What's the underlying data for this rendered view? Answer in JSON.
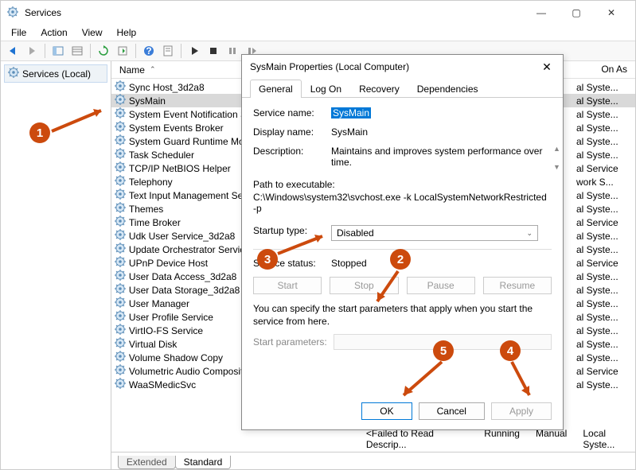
{
  "window": {
    "title": "Services",
    "menus": [
      "File",
      "Action",
      "View",
      "Help"
    ],
    "tree_node": "Services (Local)"
  },
  "list": {
    "col_name": "Name",
    "col_logon": "On As",
    "items": [
      {
        "name": "Sync Host_3d2a8",
        "logon": "al Syste..."
      },
      {
        "name": "SysMain",
        "logon": "al Syste...",
        "selected": true
      },
      {
        "name": "System Event Notification Se",
        "logon": "al Syste..."
      },
      {
        "name": "System Events Broker",
        "logon": "al Syste..."
      },
      {
        "name": "System Guard Runtime Mon",
        "logon": "al Syste..."
      },
      {
        "name": "Task Scheduler",
        "logon": "al Syste..."
      },
      {
        "name": "TCP/IP NetBIOS Helper",
        "logon": "al Service"
      },
      {
        "name": "Telephony",
        "logon": "work S..."
      },
      {
        "name": "Text Input Management Servi",
        "logon": "al Syste..."
      },
      {
        "name": "Themes",
        "logon": "al Syste..."
      },
      {
        "name": "Time Broker",
        "logon": "al Service"
      },
      {
        "name": "Udk User Service_3d2a8",
        "logon": "al Syste..."
      },
      {
        "name": "Update Orchestrator Service",
        "logon": "al Syste..."
      },
      {
        "name": "UPnP Device Host",
        "logon": "al Service"
      },
      {
        "name": "User Data Access_3d2a8",
        "logon": "al Syste..."
      },
      {
        "name": "User Data Storage_3d2a8",
        "logon": "al Syste..."
      },
      {
        "name": "User Manager",
        "logon": "al Syste..."
      },
      {
        "name": "User Profile Service",
        "logon": "al Syste..."
      },
      {
        "name": "VirtIO-FS Service",
        "logon": "al Syste..."
      },
      {
        "name": "Virtual Disk",
        "logon": "al Syste..."
      },
      {
        "name": "Volume Shadow Copy",
        "logon": "al Syste..."
      },
      {
        "name": "Volumetric Audio Composito",
        "logon": "al Service"
      },
      {
        "name": "WaaSMedicSvc",
        "logon": "al Syste..."
      }
    ],
    "bottom_tabs": {
      "extended": "Extended",
      "standard": "Standard"
    },
    "status_cells": {
      "desc": "<Failed to Read Descrip...",
      "state": "Running",
      "startup": "Manual",
      "logon": "Local Syste..."
    }
  },
  "dialog": {
    "title": "SysMain Properties (Local Computer)",
    "tabs": [
      "General",
      "Log On",
      "Recovery",
      "Dependencies"
    ],
    "labels": {
      "service_name": "Service name:",
      "display_name": "Display name:",
      "description": "Description:",
      "path": "Path to executable:",
      "startup": "Startup type:",
      "status": "Service status:",
      "note": "You can specify the start parameters that apply when you start the service from here.",
      "start_params": "Start parameters:"
    },
    "values": {
      "service_name": "SysMain",
      "display_name": "SysMain",
      "description": "Maintains and improves system performance over time.",
      "path": "C:\\Windows\\system32\\svchost.exe -k LocalSystemNetworkRestricted -p",
      "startup": "Disabled",
      "status": "Stopped"
    },
    "buttons": {
      "start": "Start",
      "stop": "Stop",
      "pause": "Pause",
      "resume": "Resume",
      "ok": "OK",
      "cancel": "Cancel",
      "apply": "Apply"
    }
  },
  "annotations": {
    "1": "1",
    "2": "2",
    "3": "3",
    "4": "4",
    "5": "5"
  }
}
